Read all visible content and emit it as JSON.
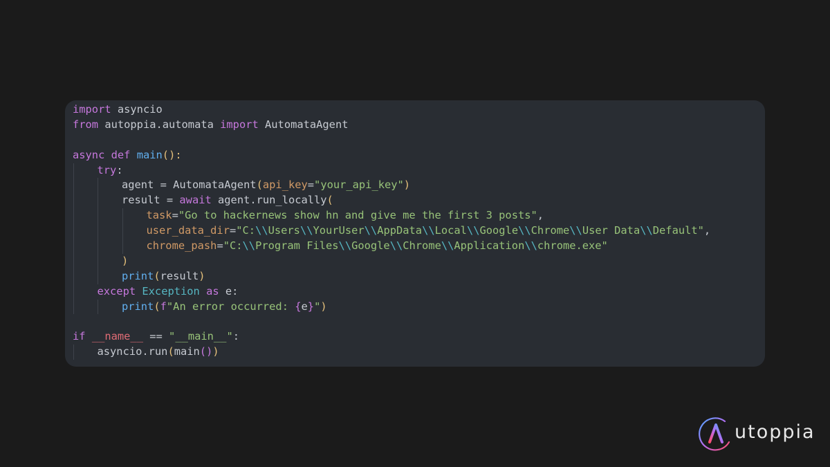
{
  "code": {
    "lines": [
      {
        "indent": 0,
        "tokens": [
          {
            "t": "import",
            "k": "kw"
          },
          {
            "t": " asyncio",
            "k": "id"
          }
        ]
      },
      {
        "indent": 0,
        "tokens": [
          {
            "t": "from",
            "k": "kw"
          },
          {
            "t": " autoppia.automata ",
            "k": "id"
          },
          {
            "t": "import",
            "k": "kw"
          },
          {
            "t": " AutomataAgent",
            "k": "id"
          }
        ]
      },
      {
        "indent": 0,
        "tokens": []
      },
      {
        "indent": 0,
        "tokens": [
          {
            "t": "async",
            "k": "kw"
          },
          {
            "t": " ",
            "k": "id"
          },
          {
            "t": "def",
            "k": "kw"
          },
          {
            "t": " ",
            "k": "id"
          },
          {
            "t": "main",
            "k": "fn"
          },
          {
            "t": "():",
            "k": "par"
          }
        ]
      },
      {
        "indent": 1,
        "tokens": [
          {
            "t": "try",
            "k": "kw"
          },
          {
            "t": ":",
            "k": "id"
          }
        ]
      },
      {
        "indent": 2,
        "tokens": [
          {
            "t": "agent = ",
            "k": "id"
          },
          {
            "t": "AutomataAgent",
            "k": "id"
          },
          {
            "t": "(",
            "k": "par"
          },
          {
            "t": "api_key",
            "k": "arg"
          },
          {
            "t": "=",
            "k": "op"
          },
          {
            "t": "\"your_api_key\"",
            "k": "str"
          },
          {
            "t": ")",
            "k": "par"
          }
        ]
      },
      {
        "indent": 2,
        "tokens": [
          {
            "t": "result = ",
            "k": "id"
          },
          {
            "t": "await",
            "k": "kw"
          },
          {
            "t": " agent.run_locally",
            "k": "id"
          },
          {
            "t": "(",
            "k": "par"
          }
        ]
      },
      {
        "indent": 3,
        "tokens": [
          {
            "t": "task",
            "k": "arg"
          },
          {
            "t": "=",
            "k": "op"
          },
          {
            "t": "\"Go to hackernews show hn and give me the first 3 posts\"",
            "k": "str"
          },
          {
            "t": ",",
            "k": "op"
          }
        ]
      },
      {
        "indent": 3,
        "tokens": [
          {
            "t": "user_data_dir",
            "k": "arg"
          },
          {
            "t": "=",
            "k": "op"
          },
          {
            "t": "\"C:",
            "k": "str"
          },
          {
            "t": "\\\\",
            "k": "esc"
          },
          {
            "t": "Users",
            "k": "str"
          },
          {
            "t": "\\\\",
            "k": "esc"
          },
          {
            "t": "YourUser",
            "k": "str"
          },
          {
            "t": "\\\\",
            "k": "esc"
          },
          {
            "t": "AppData",
            "k": "str"
          },
          {
            "t": "\\\\",
            "k": "esc"
          },
          {
            "t": "Local",
            "k": "str"
          },
          {
            "t": "\\\\",
            "k": "esc"
          },
          {
            "t": "Google",
            "k": "str"
          },
          {
            "t": "\\\\",
            "k": "esc"
          },
          {
            "t": "Chrome",
            "k": "str"
          },
          {
            "t": "\\\\",
            "k": "esc"
          },
          {
            "t": "User Data",
            "k": "str"
          },
          {
            "t": "\\\\",
            "k": "esc"
          },
          {
            "t": "Default\"",
            "k": "str"
          },
          {
            "t": ",",
            "k": "op"
          }
        ]
      },
      {
        "indent": 3,
        "tokens": [
          {
            "t": "chrome_pash",
            "k": "arg"
          },
          {
            "t": "=",
            "k": "op"
          },
          {
            "t": "\"C:",
            "k": "str"
          },
          {
            "t": "\\\\",
            "k": "esc"
          },
          {
            "t": "Program Files",
            "k": "str"
          },
          {
            "t": "\\\\",
            "k": "esc"
          },
          {
            "t": "Google",
            "k": "str"
          },
          {
            "t": "\\\\",
            "k": "esc"
          },
          {
            "t": "Chrome",
            "k": "str"
          },
          {
            "t": "\\\\",
            "k": "esc"
          },
          {
            "t": "Application",
            "k": "str"
          },
          {
            "t": "\\\\",
            "k": "esc"
          },
          {
            "t": "chrome.exe\"",
            "k": "str"
          }
        ]
      },
      {
        "indent": 2,
        "tokens": [
          {
            "t": ")",
            "k": "par"
          }
        ]
      },
      {
        "indent": 2,
        "tokens": [
          {
            "t": "print",
            "k": "fn"
          },
          {
            "t": "(",
            "k": "par"
          },
          {
            "t": "result",
            "k": "id"
          },
          {
            "t": ")",
            "k": "par"
          }
        ]
      },
      {
        "indent": 1,
        "tokens": [
          {
            "t": "except",
            "k": "kw"
          },
          {
            "t": " ",
            "k": "id"
          },
          {
            "t": "Exception",
            "k": "exc"
          },
          {
            "t": " ",
            "k": "id"
          },
          {
            "t": "as",
            "k": "kw"
          },
          {
            "t": " e:",
            "k": "id"
          }
        ]
      },
      {
        "indent": 2,
        "tokens": [
          {
            "t": "print",
            "k": "fn"
          },
          {
            "t": "(",
            "k": "par"
          },
          {
            "t": "f",
            "k": "kw"
          },
          {
            "t": "\"An error occurred: ",
            "k": "str"
          },
          {
            "t": "{",
            "k": "brc"
          },
          {
            "t": "e",
            "k": "id"
          },
          {
            "t": "}",
            "k": "brc"
          },
          {
            "t": "\"",
            "k": "str"
          },
          {
            "t": ")",
            "k": "par"
          }
        ]
      },
      {
        "indent": 0,
        "tokens": []
      },
      {
        "indent": 0,
        "tokens": [
          {
            "t": "if",
            "k": "kw"
          },
          {
            "t": " ",
            "k": "id"
          },
          {
            "t": "__name__",
            "k": "dun"
          },
          {
            "t": " == ",
            "k": "op"
          },
          {
            "t": "\"__main__\"",
            "k": "str"
          },
          {
            "t": ":",
            "k": "id"
          }
        ]
      },
      {
        "indent": 1,
        "tokens": [
          {
            "t": "asyncio.run",
            "k": "id"
          },
          {
            "t": "(",
            "k": "par"
          },
          {
            "t": "main",
            "k": "id"
          },
          {
            "t": "()",
            "k": "par2"
          },
          {
            "t": ")",
            "k": "par"
          }
        ]
      }
    ]
  },
  "brand": {
    "name": "utoppia",
    "logo_icon": "autoppia-a-logo-icon"
  },
  "colors": {
    "background": "#1b1b1b",
    "panel": "#292d33",
    "keyword": "#c678dd",
    "function": "#61afef",
    "string": "#98c379",
    "escape": "#56b6c2",
    "paren": "#e5c07b",
    "argument": "#d19a66",
    "dunder": "#e06c75"
  }
}
